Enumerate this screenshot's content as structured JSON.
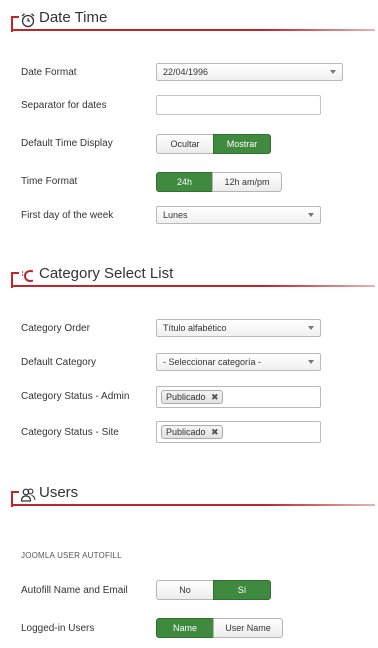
{
  "sections": {
    "datetime": {
      "title": "Date Time",
      "icon": "alarm-clock-icon"
    },
    "category": {
      "title": "Category Select List",
      "icon": "category-list-icon"
    },
    "users": {
      "title": "Users",
      "icon": "users-icon"
    }
  },
  "datetime": {
    "date_format": {
      "label": "Date Format",
      "value": "22/04/1996"
    },
    "separator": {
      "label": "Separator for dates",
      "value": ""
    },
    "default_time_display": {
      "label": "Default Time Display",
      "options": [
        "Ocultar",
        "Mostrar"
      ],
      "selected": "Mostrar"
    },
    "time_format": {
      "label": "Time Format",
      "options": [
        "24h",
        "12h am/pm"
      ],
      "selected": "24h"
    },
    "first_day": {
      "label": "First day of the week",
      "value": "Lunes"
    }
  },
  "category": {
    "order": {
      "label": "Category Order",
      "value": "Título alfabético"
    },
    "default": {
      "label": "Default Category",
      "value": "- Seleccionar categoría -"
    },
    "status_admin": {
      "label": "Category Status - Admin",
      "chip": "Publicado",
      "remove": "✖"
    },
    "status_site": {
      "label": "Category Status - Site",
      "chip": "Publicado",
      "remove": "✖"
    }
  },
  "users": {
    "autofill_heading": "JOOMLA USER AUTOFILL",
    "autofill": {
      "label": "Autofill Name and Email",
      "options": [
        "No",
        "Sí"
      ],
      "selected": "Sí"
    },
    "logged_in": {
      "label": "Logged-in Users",
      "options": [
        "Name",
        "User Name"
      ],
      "selected": "Name"
    }
  },
  "colors": {
    "accent": "#c0252a",
    "active_button": "#3f8a3f"
  }
}
